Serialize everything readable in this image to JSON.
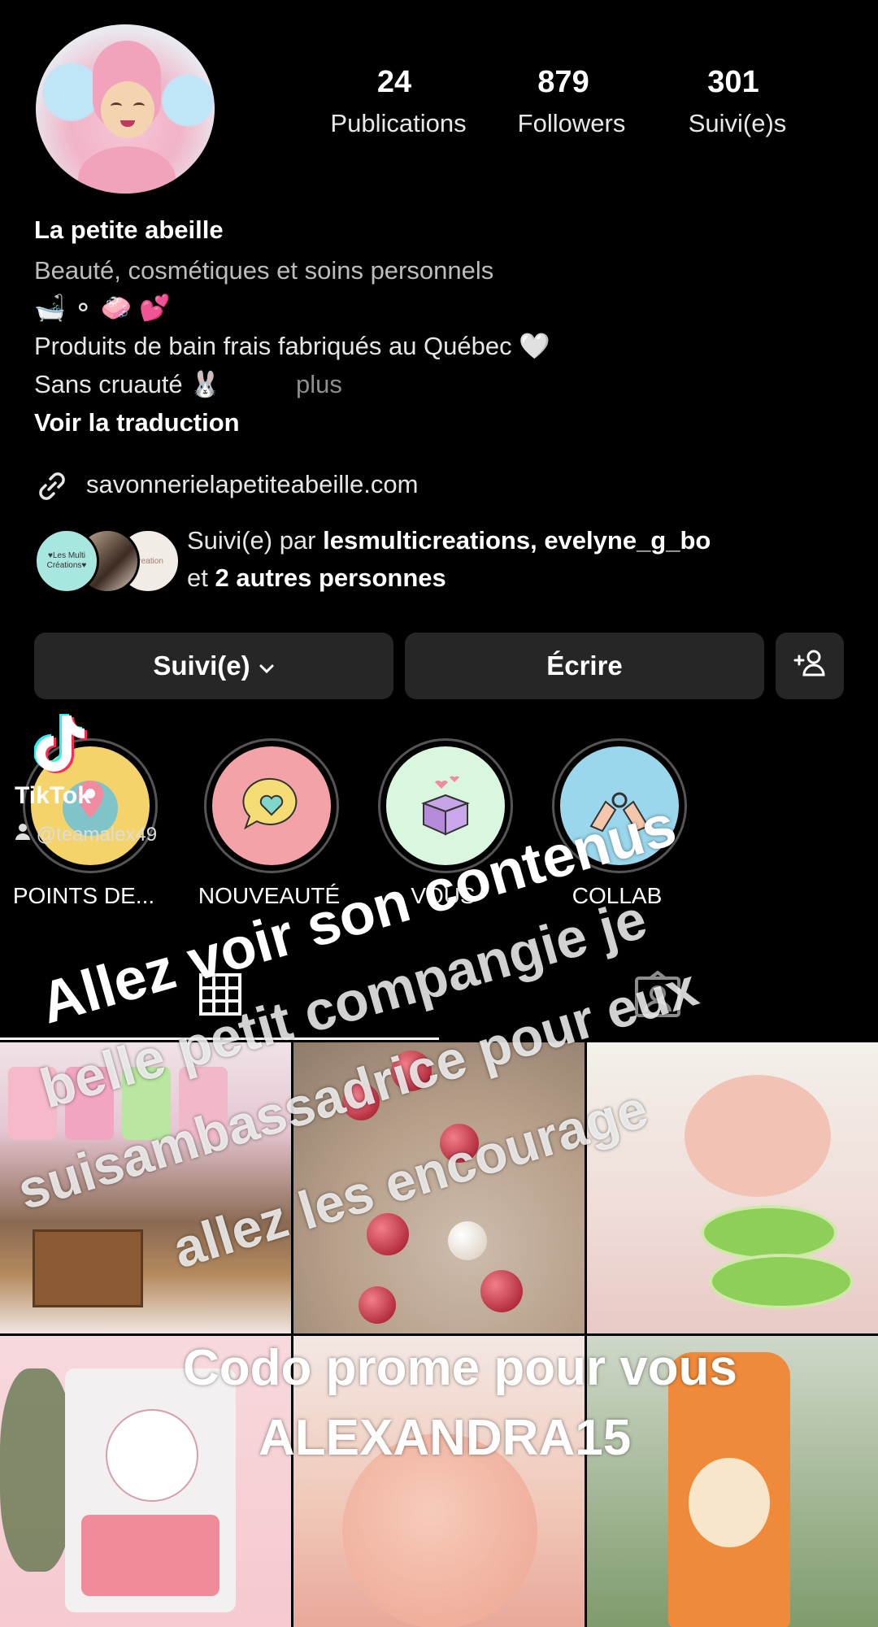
{
  "profile": {
    "stats": [
      {
        "num": "24",
        "label": "Publications"
      },
      {
        "num": "879",
        "label": "Followers"
      },
      {
        "num": "301",
        "label": "Suivi(e)s"
      }
    ],
    "name": "La petite abeille",
    "category": "Beauté, cosmétiques et soins personnels",
    "bio_emoji_line": "🛁 ⚬ 🧼 💕",
    "bio_line1": "Produits de bain frais fabriqués au Québec 🤍",
    "bio_line2": "Sans cruauté 🐰",
    "more": "plus",
    "translate": "Voir la traduction",
    "link": "savonnerielapetiteabeille.com",
    "followed_prefix": "Suivi(e) par ",
    "followed_names": "lesmulticreations, evelyne_g_bo",
    "followed_and": "et ",
    "followed_others": "2 autres personnes",
    "mutual_avatar_text": "♥Les Multi Créations♥"
  },
  "buttons": {
    "following": "Suivi(e)",
    "message": "Écrire"
  },
  "highlights": [
    {
      "label": "POINTS DE...",
      "color": "#f3d36a"
    },
    {
      "label": "NOUVEAUTÉ",
      "color": "#f3a3a8"
    },
    {
      "label": "VOUS",
      "color": "#d9f6df"
    },
    {
      "label": "COLLAB",
      "color": "#9ad7ec"
    }
  ],
  "tiktok": {
    "brand": "TikTok",
    "handle": "@teamalex49"
  },
  "overlay": {
    "line1": "Allez voir son contenus",
    "line2": "belle petit compangie  je",
    "line3": "suisambassadrice pour eux",
    "line4": "allez les encourage",
    "line5": "Codo prome pour vous",
    "line6": "ALEXANDRA15"
  },
  "colors": {
    "background": "#000000",
    "button": "#262626"
  }
}
